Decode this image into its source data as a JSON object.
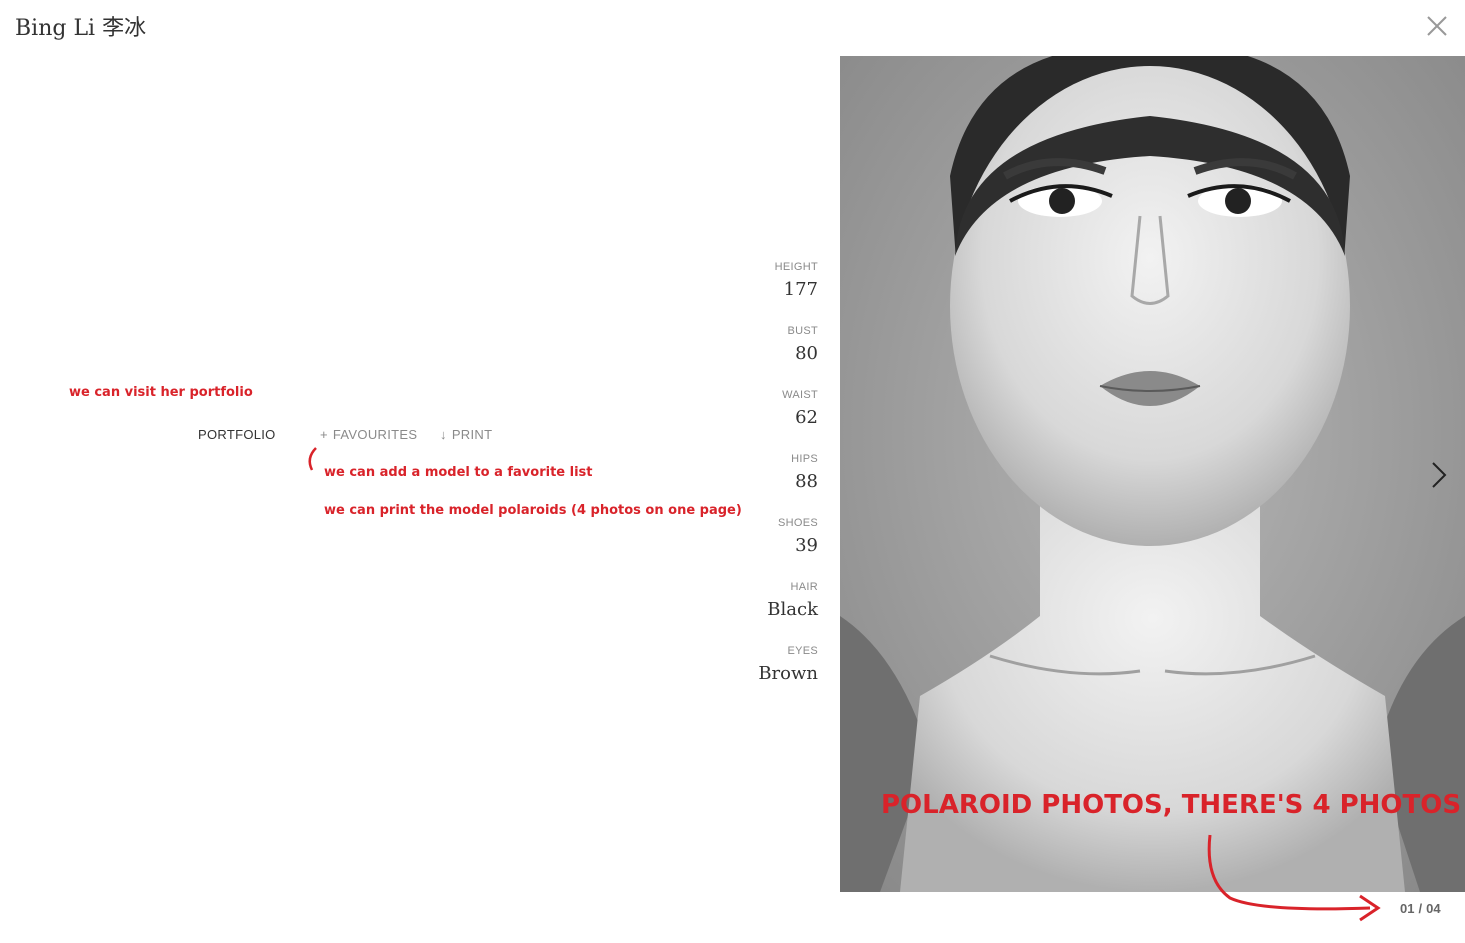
{
  "header": {
    "model_name": "Bing Li 李冰",
    "close_icon": "close-icon"
  },
  "actions": {
    "portfolio_label": "PORTFOLIO",
    "favourites_icon": "plus-icon",
    "favourites_glyph": "+",
    "favourites_label": "FAVOURITES",
    "print_icon": "download-arrow-icon",
    "print_glyph": "↓",
    "print_label": "PRINT"
  },
  "annotations": {
    "portfolio_note": "we can visit her portfolio",
    "favourites_note": "we can add a model to a favorite list",
    "print_note": "we can print the model polaroids (4 photos on one page)",
    "polaroid_note": "POLAROID PHOTOS, THERE'S 4 PHOTOS",
    "color": "#d9232a"
  },
  "stats": [
    {
      "label": "HEIGHT",
      "value": "177"
    },
    {
      "label": "BUST",
      "value": "80"
    },
    {
      "label": "WAIST",
      "value": "62"
    },
    {
      "label": "HIPS",
      "value": "88"
    },
    {
      "label": "SHOES",
      "value": "39"
    },
    {
      "label": "HAIR",
      "value": "Black"
    },
    {
      "label": "EYES",
      "value": "Brown"
    }
  ],
  "gallery": {
    "photo_description_icon": "model-polaroid-photo",
    "next_icon": "chevron-right-icon",
    "current": "01",
    "separator": "/",
    "total": "04"
  }
}
